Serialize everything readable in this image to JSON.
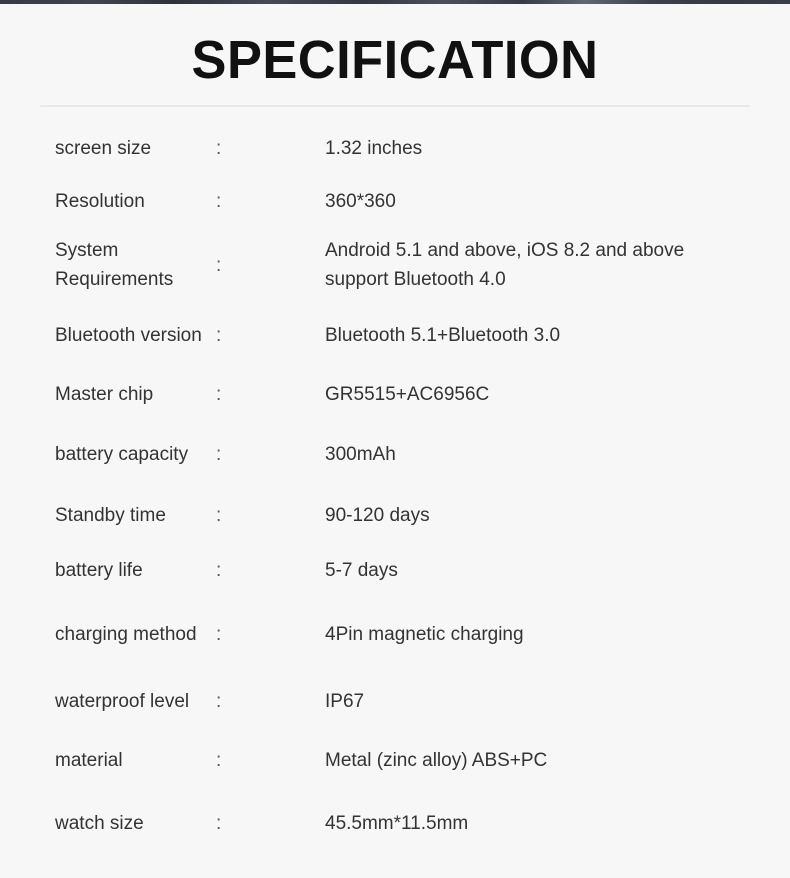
{
  "document": {
    "title": "SPECIFICATION",
    "separator": ":",
    "background_color": "#f7f7f7",
    "text_color": "#333333",
    "title_color": "#111111",
    "divider_color": "#e9e9e9"
  },
  "specs": [
    {
      "label": "screen size",
      "value": "1.32 inches"
    },
    {
      "label": "Resolution",
      "value": "360*360"
    },
    {
      "label": "System Requirements",
      "value": "Android 5.1 and above, iOS 8.2 and above\nsupport Bluetooth 4.0"
    },
    {
      "label": "Bluetooth version",
      "value": "Bluetooth 5.1+Bluetooth 3.0"
    },
    {
      "label": "Master chip",
      "value": "GR5515+AC6956C"
    },
    {
      "label": "battery capacity",
      "value": "300mAh"
    },
    {
      "label": "Standby time",
      "value": "90-120 days"
    },
    {
      "label": "battery life",
      "value": "5-7 days"
    },
    {
      "label": "charging method",
      "value": "4Pin magnetic charging"
    },
    {
      "label": "waterproof level",
      "value": "IP67"
    },
    {
      "label": "material",
      "value": "Metal (zinc alloy) ABS+PC"
    },
    {
      "label": "watch size",
      "value": "45.5mm*11.5mm"
    }
  ]
}
